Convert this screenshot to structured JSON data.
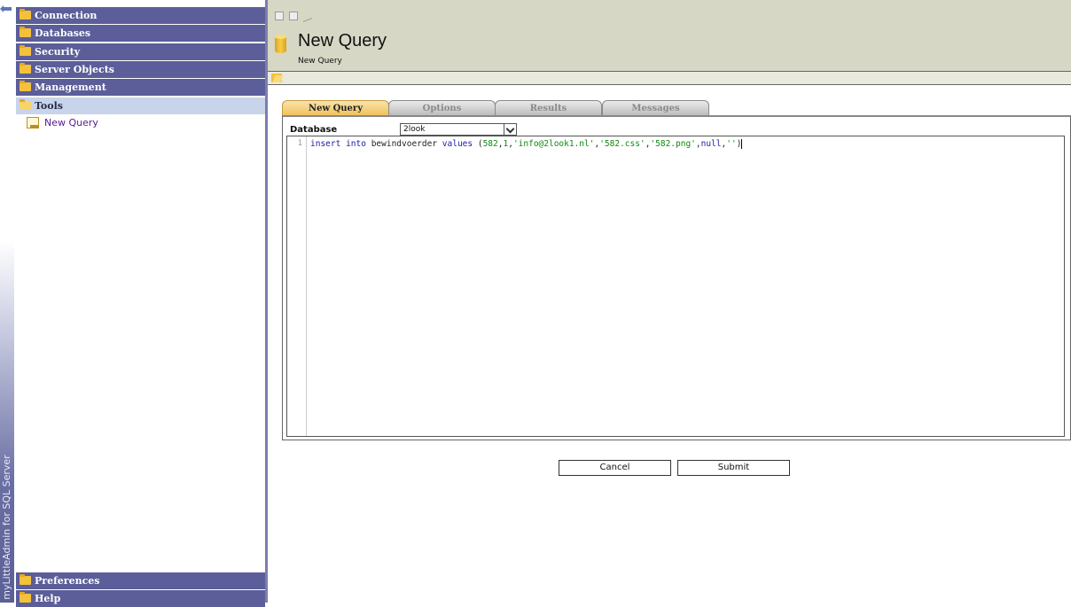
{
  "app": {
    "vertical_title": "myLittleAdmin for SQL Server"
  },
  "sidebar": {
    "items": [
      {
        "label": "Connection"
      },
      {
        "label": "Databases"
      },
      {
        "label": "Security"
      },
      {
        "label": "Server Objects"
      },
      {
        "label": "Management"
      },
      {
        "label": "Tools"
      }
    ],
    "tools_children": [
      {
        "label": "New Query"
      }
    ],
    "bottom_items": [
      {
        "label": "Preferences"
      },
      {
        "label": "Help"
      }
    ]
  },
  "header": {
    "title": "New Query",
    "subtitle": "New Query"
  },
  "tabs": [
    {
      "label": "New Query",
      "active": true
    },
    {
      "label": "Options",
      "active": false
    },
    {
      "label": "Results",
      "active": false
    },
    {
      "label": "Messages",
      "active": false
    }
  ],
  "query_form": {
    "database_label": "Database",
    "database_value": "2look",
    "line_number": "1",
    "code": {
      "kw1": "insert",
      "kw2": "into",
      "table": "bewindvoerder",
      "kw3": "values",
      "open": "(",
      "n1": "582",
      "c1": ",",
      "n2": "1",
      "c2": ",",
      "s1": "'info@2look1.nl'",
      "c3": ",",
      "s2": "'582.css'",
      "c4": ",",
      "s3": "'582.png'",
      "c5": ",",
      "kw4": "null",
      "c6": ",",
      "s4": "''",
      "close": ")"
    }
  },
  "buttons": {
    "cancel": "Cancel",
    "submit": "Submit"
  },
  "colors": {
    "sidebar_item_bg": "#5b5e98",
    "sidebar_active_bg": "#c8d4ea",
    "header_bg": "#d7d7c5",
    "active_tab": "#f0c25a"
  }
}
